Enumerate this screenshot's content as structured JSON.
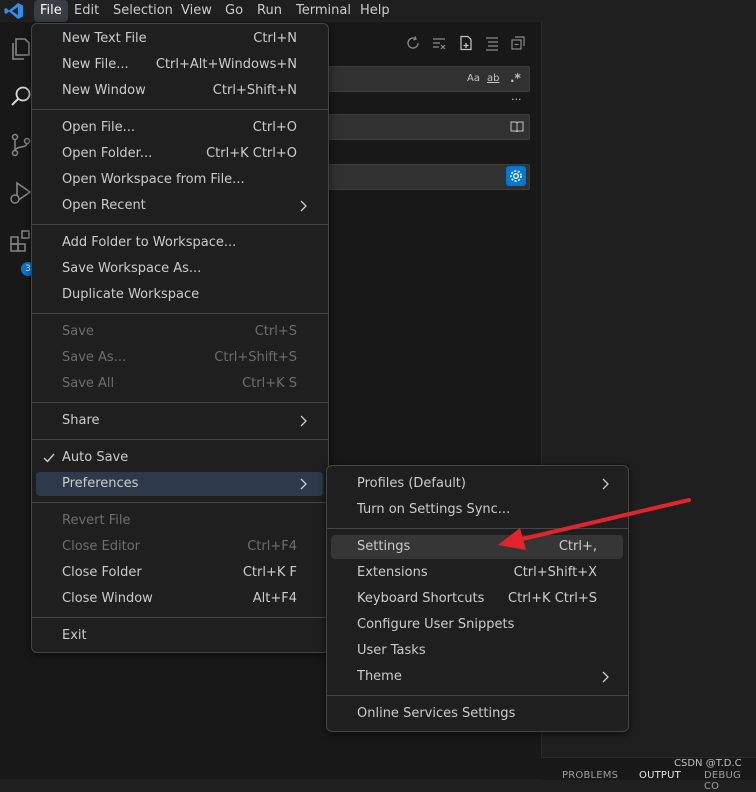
{
  "menubar": {
    "items": [
      "File",
      "Edit",
      "Selection",
      "View",
      "Go",
      "Run",
      "Terminal",
      "Help"
    ]
  },
  "activitybar": {
    "extensions_badge": "3"
  },
  "file_menu": {
    "items": [
      {
        "label": "New Text File",
        "shortcut": "Ctrl+N"
      },
      {
        "label": "New File...",
        "shortcut": "Ctrl+Alt+Windows+N"
      },
      {
        "label": "New Window",
        "shortcut": "Ctrl+Shift+N"
      },
      {
        "label": "Open File...",
        "shortcut": "Ctrl+O"
      },
      {
        "label": "Open Folder...",
        "shortcut": "Ctrl+K Ctrl+O"
      },
      {
        "label": "Open Workspace from File...",
        "shortcut": ""
      },
      {
        "label": "Open Recent",
        "shortcut": ""
      },
      {
        "label": "Add Folder to Workspace...",
        "shortcut": ""
      },
      {
        "label": "Save Workspace As...",
        "shortcut": ""
      },
      {
        "label": "Duplicate Workspace",
        "shortcut": ""
      },
      {
        "label": "Save",
        "shortcut": "Ctrl+S"
      },
      {
        "label": "Save As...",
        "shortcut": "Ctrl+Shift+S"
      },
      {
        "label": "Save All",
        "shortcut": "Ctrl+K S"
      },
      {
        "label": "Share",
        "shortcut": ""
      },
      {
        "label": "Auto Save",
        "shortcut": ""
      },
      {
        "label": "Preferences",
        "shortcut": ""
      },
      {
        "label": "Revert File",
        "shortcut": ""
      },
      {
        "label": "Close Editor",
        "shortcut": "Ctrl+F4"
      },
      {
        "label": "Close Folder",
        "shortcut": "Ctrl+K F"
      },
      {
        "label": "Close Window",
        "shortcut": "Alt+F4"
      },
      {
        "label": "Exit",
        "shortcut": ""
      }
    ]
  },
  "preferences_menu": {
    "items": [
      {
        "label": "Profiles (Default)",
        "shortcut": ""
      },
      {
        "label": "Turn on Settings Sync...",
        "shortcut": ""
      },
      {
        "label": "Settings",
        "shortcut": "Ctrl+,"
      },
      {
        "label": "Extensions",
        "shortcut": "Ctrl+Shift+X"
      },
      {
        "label": "Keyboard Shortcuts",
        "shortcut": "Ctrl+K Ctrl+S"
      },
      {
        "label": "Configure User Snippets",
        "shortcut": ""
      },
      {
        "label": "User Tasks",
        "shortcut": ""
      },
      {
        "label": "Theme",
        "shortcut": ""
      },
      {
        "label": "Online Services Settings",
        "shortcut": ""
      }
    ]
  },
  "search_view": {
    "toggles": {
      "match_case": "Aa",
      "whole_word": "ab",
      "regex": ".*"
    },
    "more": "···"
  },
  "bottom_panel": {
    "tabs": [
      "PROBLEMS",
      "OUTPUT",
      "DEBUG CO"
    ]
  },
  "watermark": "CSDN @T.D.C",
  "colors": {
    "accent": "#0078d4",
    "arrow": "#e0262b",
    "menu_bg": "#1f1f1f"
  }
}
